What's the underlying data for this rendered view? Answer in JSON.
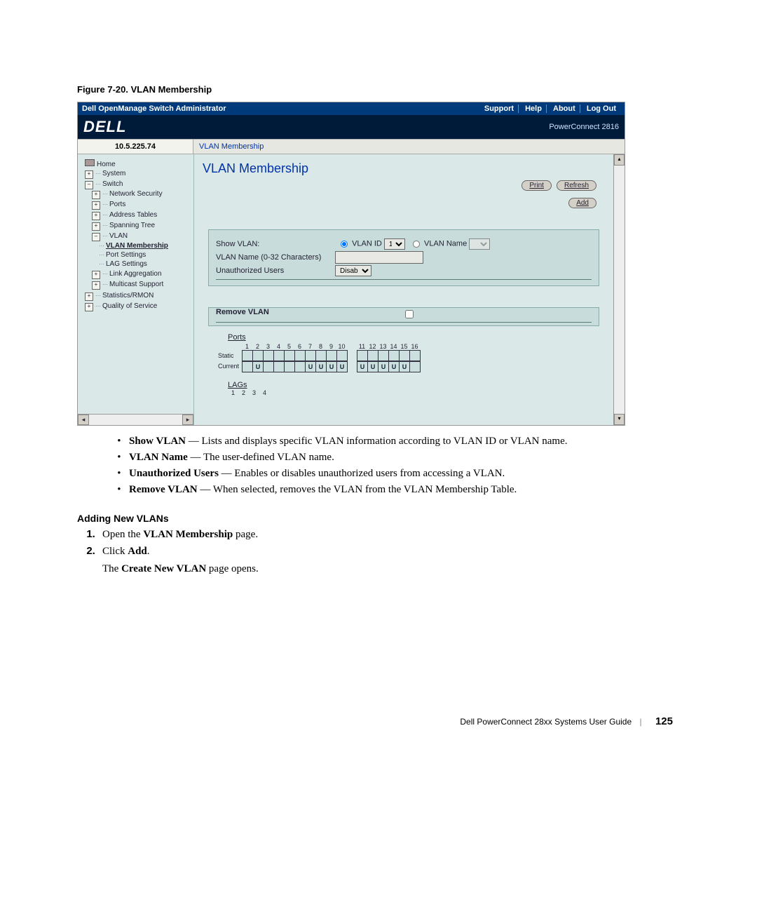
{
  "figure_caption": "Figure 7-20.    VLAN Membership",
  "topbar": {
    "title": "Dell OpenManage Switch Administrator",
    "links": [
      "Support",
      "Help",
      "About",
      "Log Out"
    ]
  },
  "logobar": {
    "logo": "DELL",
    "model": "PowerConnect 2816"
  },
  "navbar": {
    "ip": "10.5.225.74",
    "crumb": "VLAN Membership"
  },
  "tree": {
    "home": "Home",
    "system": "System",
    "switch": "Switch",
    "netsec": "Network Security",
    "ports": "Ports",
    "addr": "Address Tables",
    "stp": "Spanning Tree",
    "vlan": "VLAN",
    "vlanmem": "VLAN Membership",
    "portset": "Port Settings",
    "lagset": "LAG Settings",
    "linkagg": "Link Aggregation",
    "mcast": "Multicast Support",
    "stats": "Statistics/RMON",
    "qos": "Quality of Service"
  },
  "main": {
    "heading": "VLAN Membership",
    "print": "Print",
    "refresh": "Refresh",
    "add": "Add",
    "show_vlan": "Show VLAN:",
    "vlan_id_label": "VLAN ID",
    "vlan_id_value": "1",
    "vlan_name_label": "VLAN Name",
    "vlan_name32": "VLAN Name (0-32 Characters)",
    "unauth": "Unauthorized Users",
    "unauth_value": "Disable",
    "remove_vlan": "Remove VLAN",
    "ports_title": "Ports",
    "static": "Static",
    "current": "Current",
    "lags_title": "LAGs",
    "port_nums_a": [
      "1",
      "2",
      "3",
      "4",
      "5",
      "6",
      "7",
      "8",
      "9",
      "10"
    ],
    "port_nums_b": [
      "11",
      "12",
      "13",
      "14",
      "15",
      "16"
    ],
    "current_a": [
      "",
      "U",
      "",
      "",
      "",
      "",
      "U",
      "U",
      "U",
      "U"
    ],
    "current_b": [
      "U",
      "U",
      "U",
      "U",
      "U",
      ""
    ],
    "lag_nums": [
      "1",
      "2",
      "3",
      "4"
    ]
  },
  "doc": {
    "b1_b": "Show VLAN",
    "b1_t": " — Lists and displays specific VLAN information according to VLAN ID or VLAN name.",
    "b2_b": "VLAN Name",
    "b2_t": " — The user-defined VLAN name.",
    "b3_b": "Unauthorized Users",
    "b3_t": " — Enables or disables unauthorized users from accessing a VLAN.",
    "b4_b": "Remove VLAN",
    "b4_t": " — When selected, removes the VLAN from the VLAN Membership Table.",
    "subhead": "Adding New VLANs",
    "s1_a": "Open the ",
    "s1_b": "VLAN Membership",
    "s1_c": " page.",
    "s2_a": "Click ",
    "s2_b": "Add",
    "s2_c": ".",
    "s2_d_a": "The ",
    "s2_d_b": "Create New VLAN",
    "s2_d_c": " page opens.",
    "footer_text": "Dell PowerConnect 28xx Systems User Guide",
    "footer_page": "125"
  }
}
